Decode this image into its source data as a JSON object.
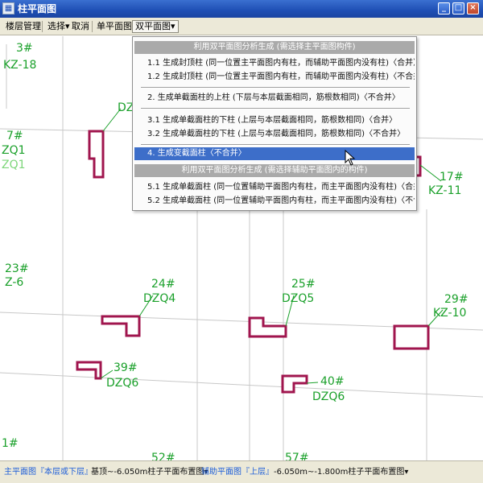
{
  "window": {
    "title": "柱平面图",
    "app_icon": "column-plan-icon",
    "buttons": {
      "minimize": "_",
      "maximize": "□",
      "close": "×"
    }
  },
  "menubar": {
    "items": [
      "楼层管理",
      "选择▾",
      "取消",
      "单平面图▾",
      "双平面图▾"
    ]
  },
  "dropdown": {
    "header1": "利用双平面图分析生成 (需选择主平面图构件)",
    "group1": [
      "1.1  生成封顶柱 (同一位置主平面图内有柱，而辅助平面图内没有柱)〈合并〉",
      "1.2  生成封顶柱 (同一位置主平面图内有柱，而辅助平面图内没有柱)〈不合并〉"
    ],
    "item2": "2.  生成单截面柱的上柱 (下层与本层截面相同，筋根数相同)〈不合并〉",
    "group3": [
      "3.1  生成单截面柱的下柱 (上层与本层截面相同，筋根数相同)〈合并〉",
      "3.2  生成单截面柱的下柱 (上层与本层截面相同，筋根数相同)〈不合并〉"
    ],
    "item4": "4.  生成变截面柱〈不合并〉",
    "header2": "利用双平面图分析生成 (需选择辅助平面图内的构件)",
    "group5": [
      "5.1  生成单截面柱 (同一位置辅助平面图内有柱，而主平面图内没有柱)〈合并〉",
      "5.2  生成单截面柱 (同一位置辅助平面图内有柱，而主平面图内没有柱)〈不合并〉"
    ]
  },
  "canvas": {
    "labels": [
      {
        "id": "c3",
        "text": "3#"
      },
      {
        "id": "c3b",
        "text": "KZ-18"
      },
      {
        "id": "dz",
        "text": "DZQ"
      },
      {
        "id": "c7",
        "text": "7#"
      },
      {
        "id": "c7b",
        "text": "ZQ1"
      },
      {
        "id": "c7c",
        "text": "ZQ1"
      },
      {
        "id": "c17",
        "text": "17#"
      },
      {
        "id": "c17b",
        "text": "KZ-11"
      },
      {
        "id": "c23",
        "text": "23#"
      },
      {
        "id": "c23b",
        "text": "Z-6"
      },
      {
        "id": "c24",
        "text": "24#"
      },
      {
        "id": "c24b",
        "text": "DZQ4"
      },
      {
        "id": "c25",
        "text": "25#"
      },
      {
        "id": "c25b",
        "text": "DZQ5"
      },
      {
        "id": "c29",
        "text": "29#"
      },
      {
        "id": "c29b",
        "text": "KZ-10"
      },
      {
        "id": "c39",
        "text": "39#"
      },
      {
        "id": "c39b",
        "text": "DZQ6"
      },
      {
        "id": "c40",
        "text": "40#"
      },
      {
        "id": "c40b",
        "text": "DZQ6"
      },
      {
        "id": "c1",
        "text": "1#"
      },
      {
        "id": "c52",
        "text": "52#"
      },
      {
        "id": "c57",
        "text": "57#"
      }
    ],
    "colors": {
      "label": "#1aa02a",
      "column": "#a0154e",
      "grid": "#c8c8c8"
    }
  },
  "statusbar": {
    "main_plan_link": "主平面图『本层或下层』",
    "main_plan_value": "基顶~-6.050m柱子平面布置图▾",
    "aux_plan_link": "辅助平面图『上层』",
    "aux_plan_value": "-6.050m~-1.800m柱子平面布置图▾"
  }
}
